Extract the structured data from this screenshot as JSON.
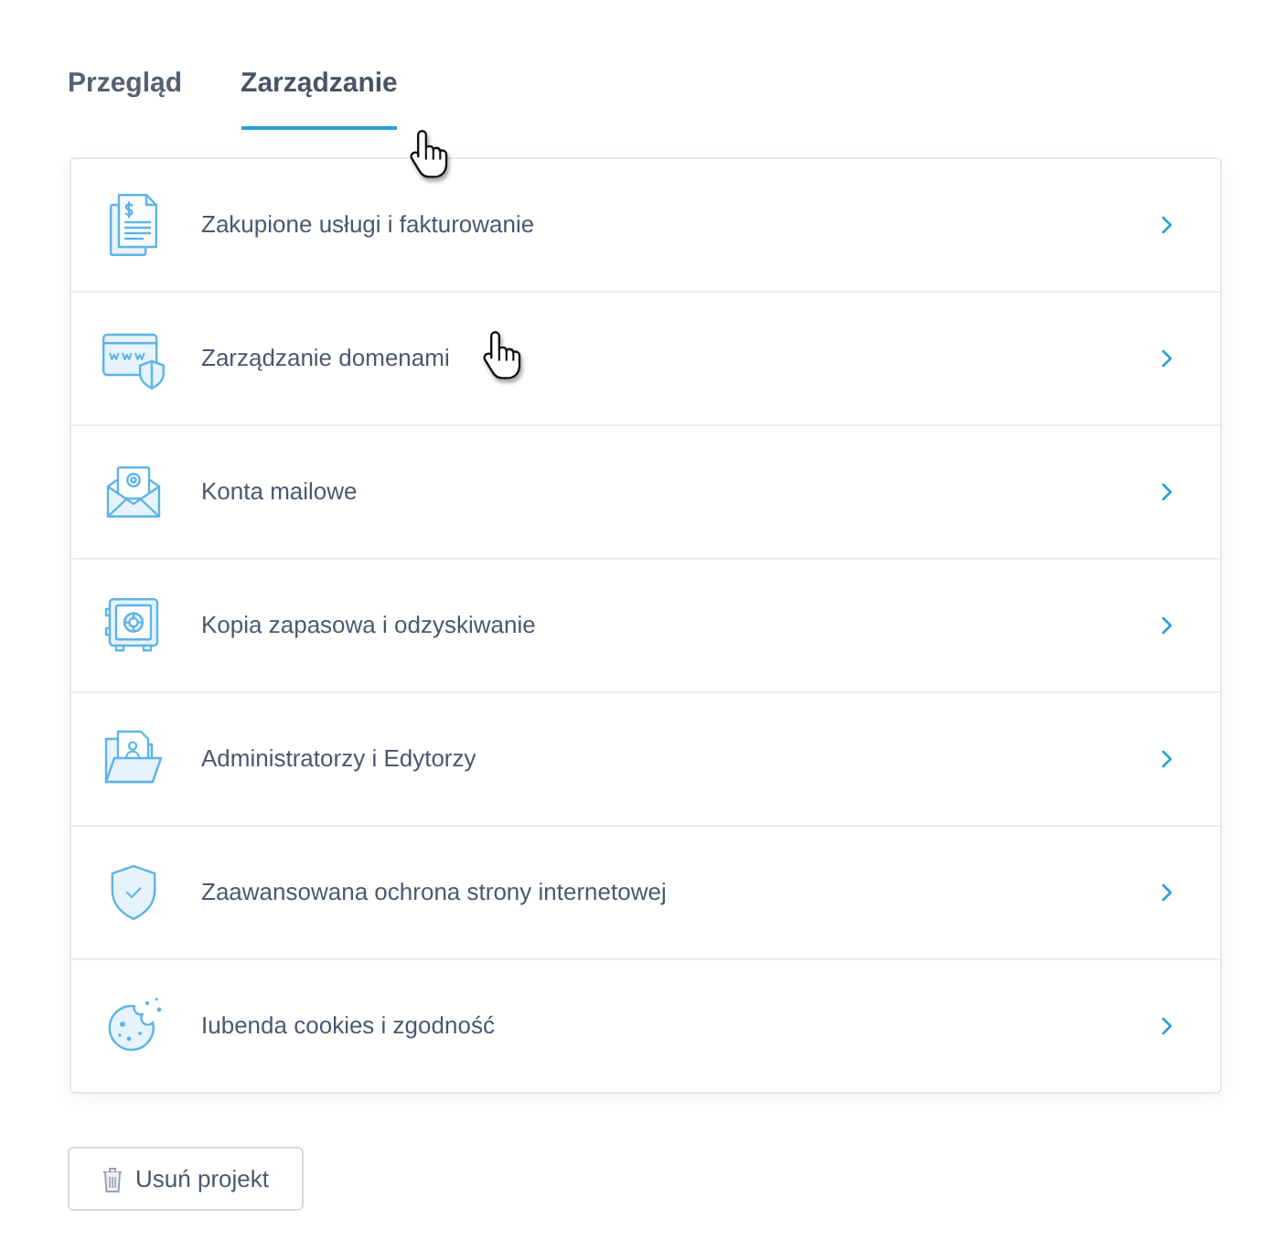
{
  "tabs": [
    {
      "label": "Przegląd",
      "selected": false,
      "hovered": false
    },
    {
      "label": "Zarządzanie",
      "selected": true,
      "hovered": true
    }
  ],
  "items": [
    {
      "kind": "billing",
      "label": "Zakupione usługi i fakturowanie",
      "hovered": false
    },
    {
      "kind": "domains",
      "label": "Zarządzanie domenami",
      "hovered": true
    },
    {
      "kind": "email",
      "label": "Konta mailowe",
      "hovered": false
    },
    {
      "kind": "backup",
      "label": "Kopia zapasowa i odzyskiwanie",
      "hovered": false
    },
    {
      "kind": "users",
      "label": "Administratorzy i Edytorzy",
      "hovered": false
    },
    {
      "kind": "security",
      "label": "Zaawansowana ochrona strony internetowej",
      "hovered": false
    },
    {
      "kind": "cookies",
      "label": "Iubenda cookies i zgodność",
      "hovered": false
    }
  ],
  "delete_button": {
    "label": "Usuń projekt"
  }
}
